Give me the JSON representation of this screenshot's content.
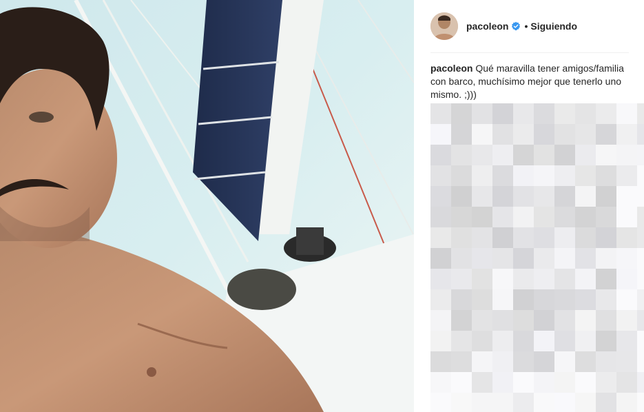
{
  "post": {
    "username": "pacoleon",
    "separator": "•",
    "follow_status": "Siguiendo",
    "caption_user": "pacoleon",
    "caption_text": "Qué maravilla tener amigos/familia con barco, muchísimo mejor que tenerlo uno mismo. ;)))",
    "icons": {
      "avatar": "profile-avatar",
      "verified": "verified-badge-icon"
    },
    "colors": {
      "verified_blue": "#3897f0",
      "text": "#262626",
      "divider": "#efefef"
    }
  }
}
